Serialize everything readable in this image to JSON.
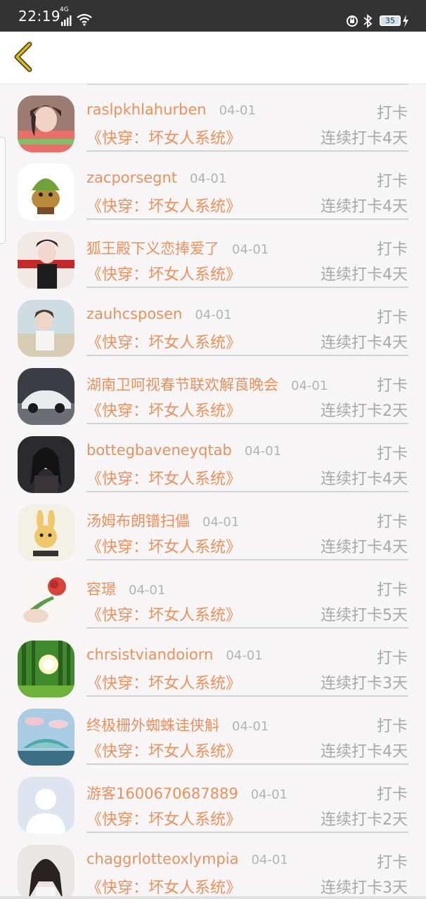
{
  "status_bar": {
    "time": "22:19",
    "network": "4G",
    "battery": "35"
  },
  "nav": {
    "back_icon": "chevron-left-icon",
    "accent": "#e6b800"
  },
  "colors": {
    "name": "#e9915d",
    "muted": "#a8a8a8"
  },
  "list": {
    "items": [
      {
        "name": "raslpkhlahurben",
        "date": "04-01",
        "action": "打卡",
        "book": "《快穿：坏女人系统》",
        "streak": "连续打卡4天"
      },
      {
        "name": "zacporsegnt",
        "date": "04-01",
        "action": "打卡",
        "book": "《快穿：坏女人系统》",
        "streak": "连续打卡4天"
      },
      {
        "name": "狐王殿下义恋捧爱了",
        "date": "04-01",
        "action": "打卡",
        "book": "《快穿：坏女人系统》",
        "streak": "连续打卡4天"
      },
      {
        "name": "zauhcsposen",
        "date": "04-01",
        "action": "打卡",
        "book": "《快穿：坏女人系统》",
        "streak": "连续打卡4天"
      },
      {
        "name": "湖南卫呵视春节联欢解莨晚会",
        "date": "04-01",
        "action": "打卡",
        "book": "《快穿：坏女人系统》",
        "streak": "连续打卡2天"
      },
      {
        "name": "bottegbaveneyqtab",
        "date": "04-01",
        "action": "打卡",
        "book": "《快穿：坏女人系统》",
        "streak": "连续打卡4天"
      },
      {
        "name": "汤姆布朗镨扫儡",
        "date": "04-01",
        "action": "打卡",
        "book": "《快穿：坏女人系统》",
        "streak": "连续打卡4天"
      },
      {
        "name": "容璟",
        "date": "04-01",
        "action": "打卡",
        "book": "《快穿：坏女人系统》",
        "streak": "连续打卡5天"
      },
      {
        "name": "chrsistviandoiorn",
        "date": "04-01",
        "action": "打卡",
        "book": "《快穿：坏女人系统》",
        "streak": "连续打卡3天"
      },
      {
        "name": "终极栅外蜘蛛诖侠斛",
        "date": "04-01",
        "action": "打卡",
        "book": "《快穿：坏女人系统》",
        "streak": "连续打卡4天"
      },
      {
        "name": "游客1600670687889",
        "date": "04-01",
        "action": "打卡",
        "book": "《快穿：坏女人系统》",
        "streak": "连续打卡2天"
      },
      {
        "name": "chaggrlotteoxlympia",
        "date": "04-01",
        "action": "打卡",
        "book": "《快穿：坏女人系统》",
        "streak": "连续打卡3天"
      }
    ]
  }
}
